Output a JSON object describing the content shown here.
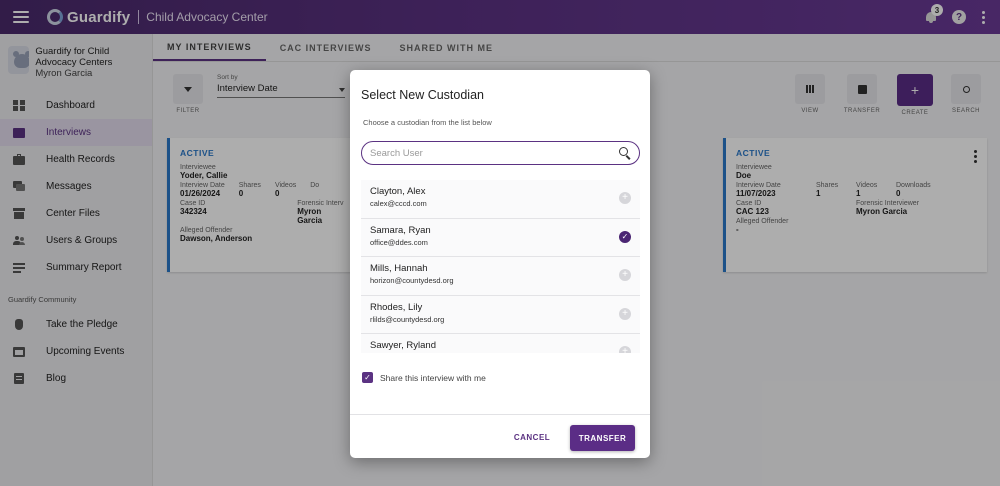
{
  "app": {
    "name": "Guardify",
    "title": "Child Advocacy Center"
  },
  "topbar": {
    "notification_count": "3",
    "help_label": "?"
  },
  "sidebar": {
    "org_name": "Guardify for Child Advocacy Centers",
    "user_name": "Myron Garcia",
    "items": [
      {
        "label": "Dashboard",
        "icon": "grid-icon"
      },
      {
        "label": "Interviews",
        "icon": "folder-icon",
        "active": true
      },
      {
        "label": "Health Records",
        "icon": "medical-bag-icon"
      },
      {
        "label": "Messages",
        "icon": "chat-icon"
      },
      {
        "label": "Center Files",
        "icon": "archive-icon"
      },
      {
        "label": "Users & Groups",
        "icon": "users-icon"
      },
      {
        "label": "Summary Report",
        "icon": "report-icon"
      }
    ],
    "community_label": "Guardify Community",
    "community_items": [
      {
        "label": "Take the Pledge",
        "icon": "hand-icon"
      },
      {
        "label": "Upcoming Events",
        "icon": "calendar-icon"
      },
      {
        "label": "Blog",
        "icon": "blog-icon"
      }
    ]
  },
  "tabs": [
    "MY INTERVIEWS",
    "CAC INTERVIEWS",
    "SHARED WITH ME"
  ],
  "toolbar": {
    "filter_label": "FILTER",
    "sort_label": "Sort by",
    "sort_value": "Interview Date",
    "view_label": "VIEW",
    "transfer_label": "TRANSFER",
    "create_label": "CREATE",
    "create_symbol": "+",
    "search_label": "SEARCH"
  },
  "cards": [
    {
      "status": "ACTIVE",
      "interviewee_label": "Interviewee",
      "interviewee": "Yoder, Callie",
      "date_label": "Interview Date",
      "date": "01/26/2024",
      "shares_label": "Shares",
      "shares": "0",
      "videos_label": "Videos",
      "videos": "0",
      "downloads_label": "Do",
      "case_label": "Case ID",
      "case_id": "342324",
      "forensic_label": "Forensic Interv",
      "forensic": "Myron Garcia",
      "offender_label": "Alleged Offender",
      "offender": "Dawson, Anderson"
    },
    {
      "status": "ACTIVE",
      "interviewee_label": "Interviewee",
      "interviewee": "Doe",
      "date_label": "Interview Date",
      "date": "11/07/2023",
      "shares_label": "Shares",
      "shares": "1",
      "videos_label": "Videos",
      "videos": "1",
      "downloads_label": "Downloads",
      "downloads": "0",
      "case_label": "Case ID",
      "case_id": "CAC 123",
      "forensic_label": "Forensic Interviewer",
      "forensic": "Myron Garcia",
      "offender_label": "Alleged Offender",
      "offender": "-"
    }
  ],
  "modal": {
    "title": "Select New Custodian",
    "subtitle": "Choose a custodian from the list below",
    "search_placeholder": "Search User",
    "custodians": [
      {
        "name": "Clayton, Alex",
        "email": "calex@cccd.com",
        "selected": false
      },
      {
        "name": "Samara, Ryan",
        "email": "office@ddes.com",
        "selected": true
      },
      {
        "name": "Mills, Hannah",
        "email": "horizon@countydesd.org",
        "selected": false
      },
      {
        "name": "Rhodes, Lily",
        "email": "rlilds@countydesd.org",
        "selected": false
      },
      {
        "name": "Sawyer, Ryland",
        "email": "",
        "selected": false
      }
    ],
    "share_label": "Share this interview with me",
    "share_checked": true,
    "cancel_label": "CANCEL",
    "transfer_label": "TRANSFER"
  },
  "colors": {
    "primary": "#5b2d86",
    "active_status": "#2a78c9"
  }
}
